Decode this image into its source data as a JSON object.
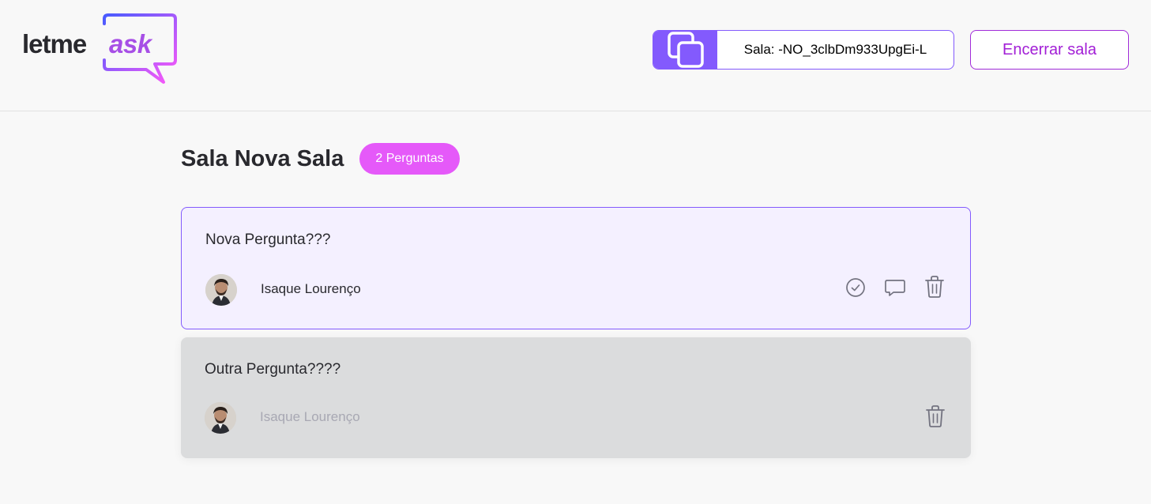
{
  "logo": {
    "word1": "letme",
    "word2": "ask",
    "accent": "#a74fe6"
  },
  "room": {
    "code_label": "Sala: -NO_3clbDm933UpgEi-L",
    "close_label": "Encerrar sala"
  },
  "page": {
    "title": "Sala Nova Sala",
    "count_label": "2 Perguntas"
  },
  "questions": [
    {
      "content": "Nova Pergunta???",
      "author": "Isaque Lourenço",
      "highlighted": true,
      "answered": false
    },
    {
      "content": "Outra Pergunta????",
      "author": "Isaque Lourenço",
      "highlighted": false,
      "answered": true
    }
  ],
  "colors": {
    "purple": "#835afd",
    "pink": "#e559f9",
    "closeText": "#a21fd6",
    "highlightBg": "#f4f0ff",
    "answeredBg": "#dbdcdd"
  },
  "icons": {
    "copy": "copy-icon",
    "check": "check-circle-icon",
    "answer": "answer-bubble-icon",
    "delete": "trash-icon"
  }
}
